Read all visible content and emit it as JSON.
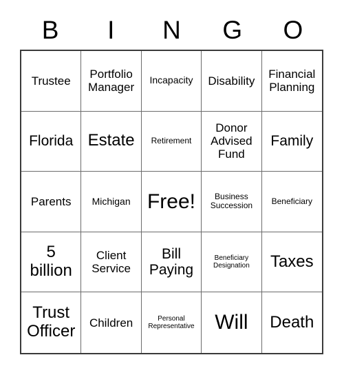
{
  "header": {
    "letters": [
      "B",
      "I",
      "N",
      "G",
      "O"
    ]
  },
  "grid": {
    "columns": 5,
    "rows": 5,
    "cells": [
      {
        "text": "Trustee",
        "size": "md"
      },
      {
        "text": "Portfolio Manager",
        "size": "md"
      },
      {
        "text": "Incapacity",
        "size": "sm"
      },
      {
        "text": "Disability",
        "size": "md"
      },
      {
        "text": "Financial Planning",
        "size": "md"
      },
      {
        "text": "Florida",
        "size": "lg"
      },
      {
        "text": "Estate",
        "size": "xl"
      },
      {
        "text": "Retirement",
        "size": "xs"
      },
      {
        "text": "Donor Advised Fund",
        "size": "md"
      },
      {
        "text": "Family",
        "size": "lg"
      },
      {
        "text": "Parents",
        "size": "md"
      },
      {
        "text": "Michigan",
        "size": "sm"
      },
      {
        "text": "Free!",
        "size": "xxl"
      },
      {
        "text": "Business Succession",
        "size": "xs"
      },
      {
        "text": "Beneficiary",
        "size": "xs"
      },
      {
        "text": "5 billion",
        "size": "xl"
      },
      {
        "text": "Client Service",
        "size": "md"
      },
      {
        "text": "Bill Paying",
        "size": "lg"
      },
      {
        "text": "Beneficiary Designation",
        "size": "xxs"
      },
      {
        "text": "Taxes",
        "size": "xl"
      },
      {
        "text": "Trust Officer",
        "size": "xl"
      },
      {
        "text": "Children",
        "size": "md"
      },
      {
        "text": "Personal Representative",
        "size": "xxs"
      },
      {
        "text": "Will",
        "size": "xxl"
      },
      {
        "text": "Death",
        "size": "xl"
      }
    ]
  }
}
